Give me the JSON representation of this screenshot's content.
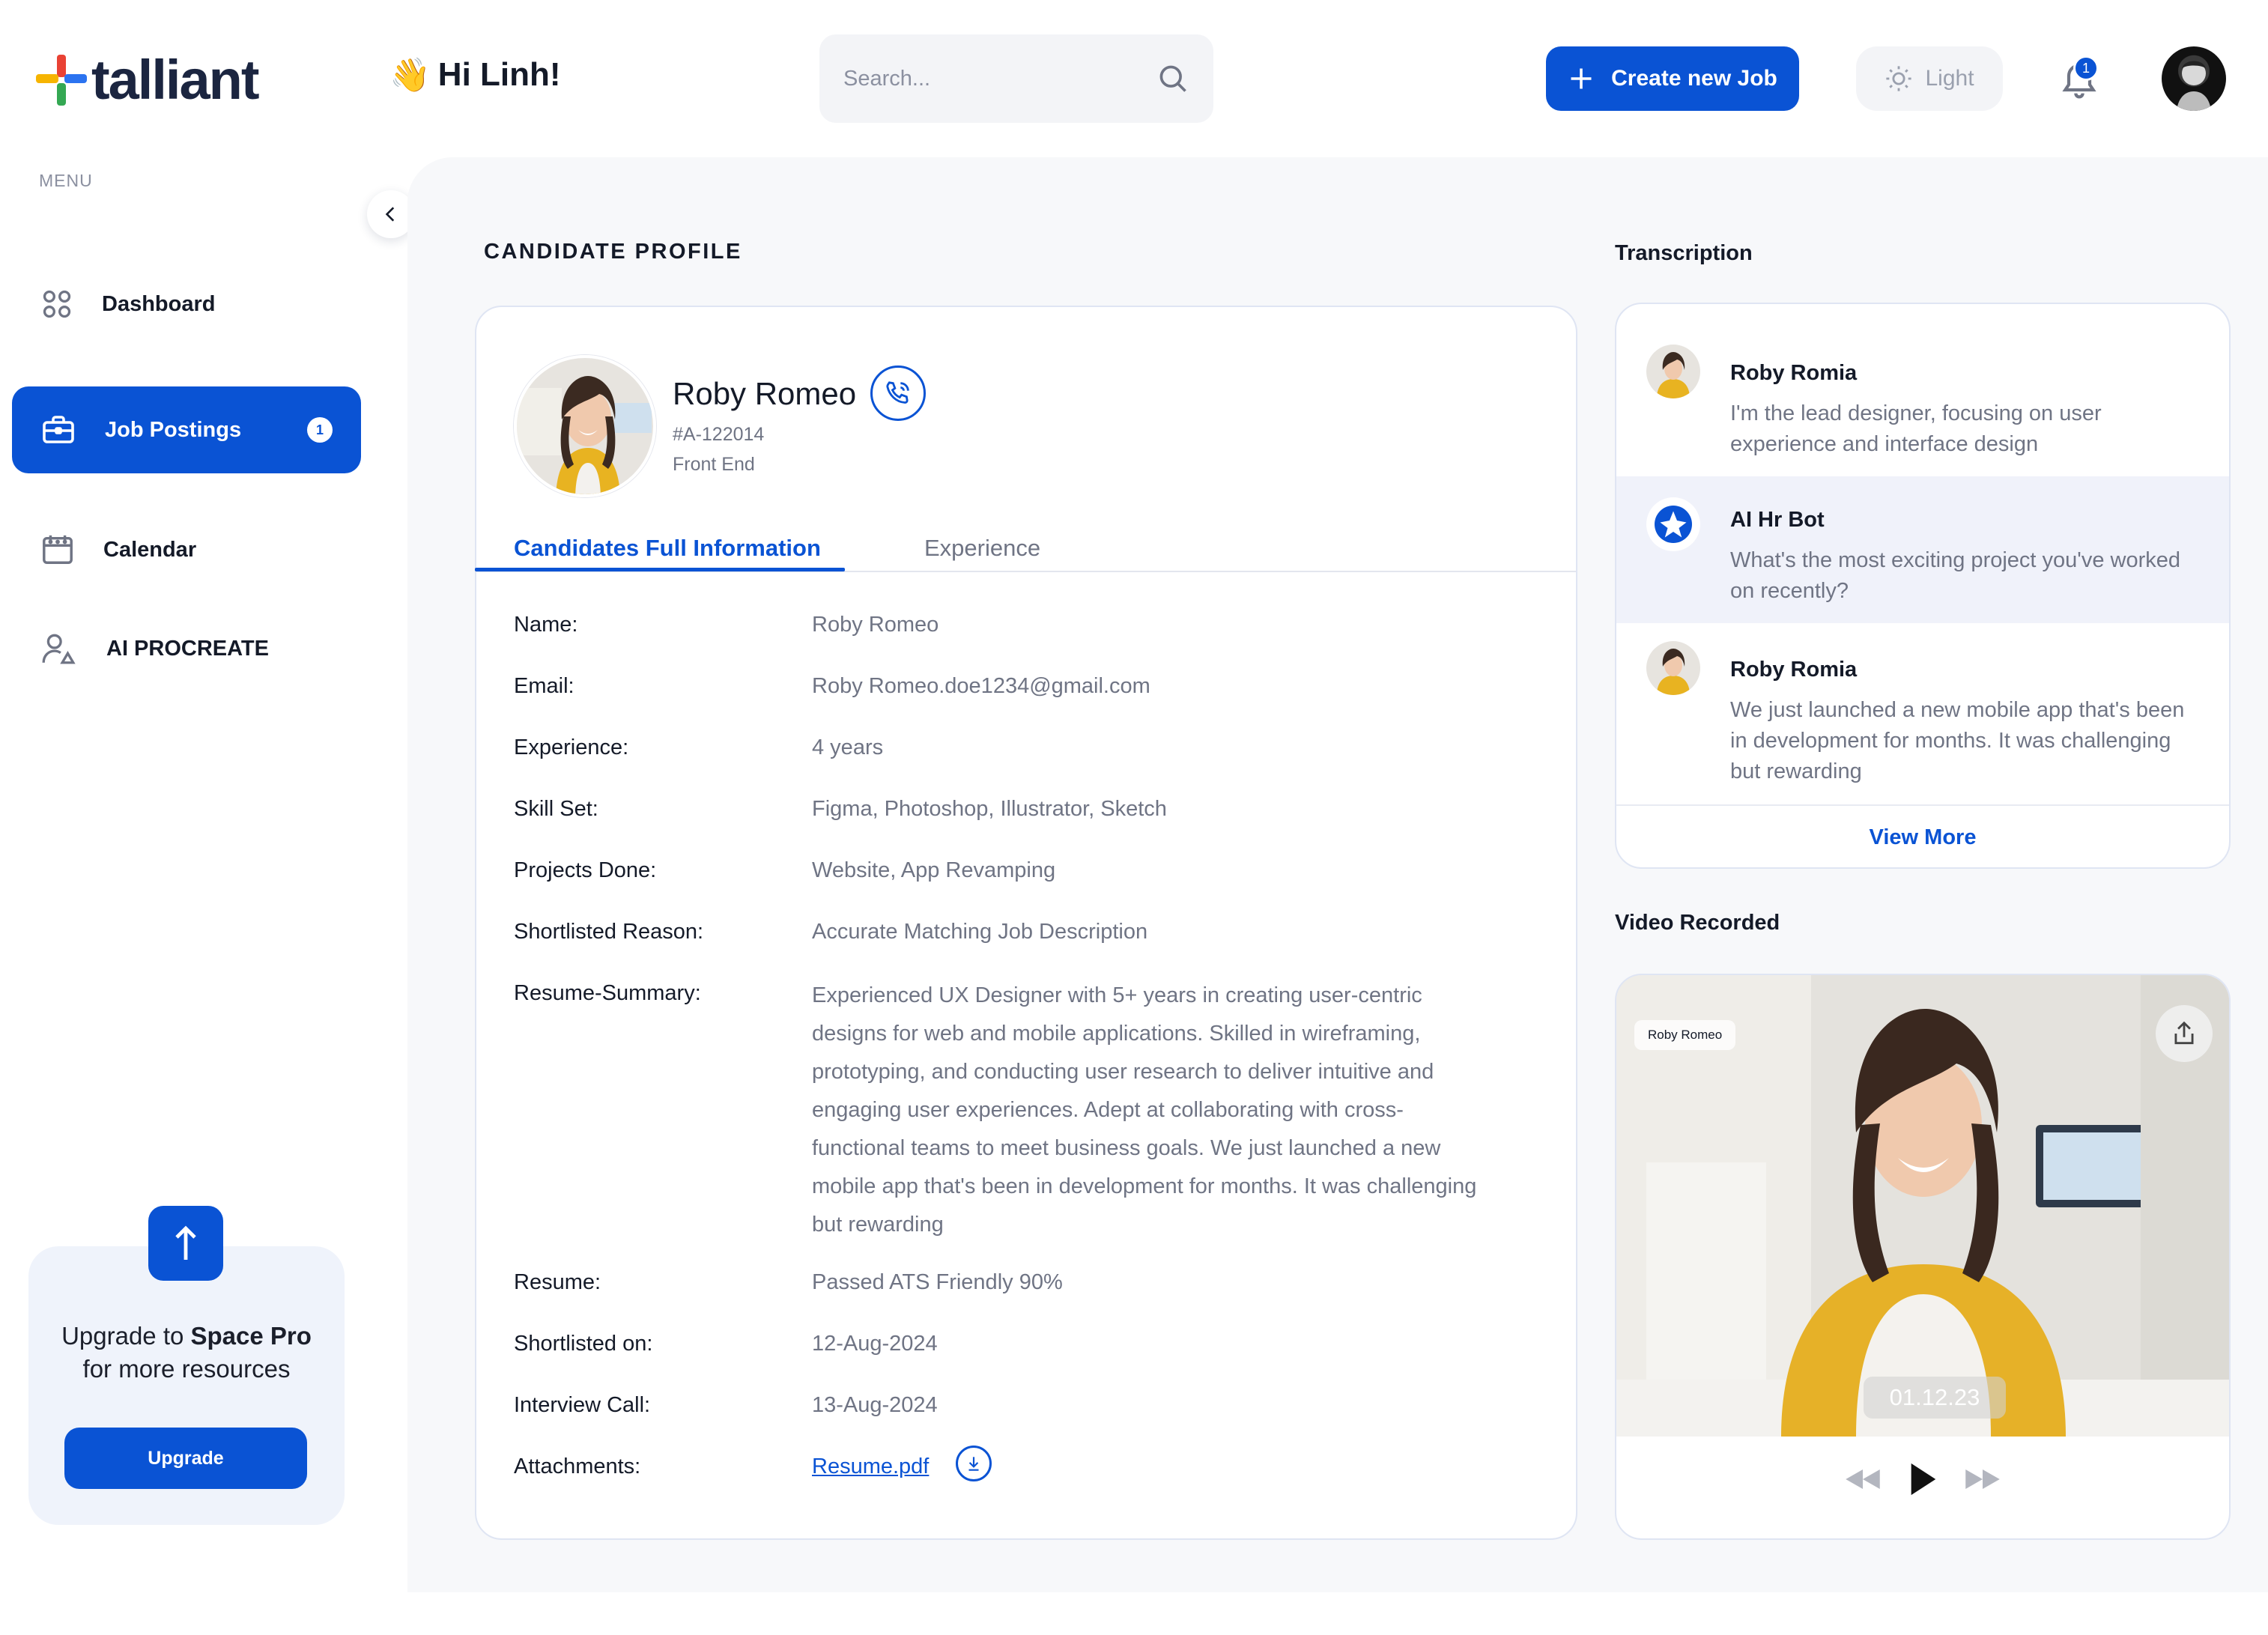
{
  "brand": {
    "name": "talliant",
    "colors": {
      "accent": "#0a53d4",
      "logo_red": "#e94234",
      "logo_yellow": "#f6b400",
      "logo_green": "#34a853",
      "logo_blue": "#2b73f0"
    }
  },
  "header": {
    "greeting_emoji": "👋",
    "greeting": "Hi Linh!",
    "search_placeholder": "Search...",
    "create_button": "Create new Job",
    "theme_label": "Light",
    "notification_count": "1"
  },
  "sidebar": {
    "menu_label": "MENU",
    "items": [
      {
        "label": "Dashboard",
        "icon": "grid-icon",
        "active": false
      },
      {
        "label": "Job Postings",
        "icon": "briefcase-icon",
        "active": true,
        "badge": "1"
      },
      {
        "label": "Calendar",
        "icon": "calendar-icon",
        "active": false
      },
      {
        "label": "AI PROCREATE",
        "icon": "user-ai-icon",
        "active": false
      }
    ],
    "upgrade": {
      "line1_prefix": "Upgrade to ",
      "line1_bold": "Space Pro",
      "line2": "for more resources",
      "button": "Upgrade"
    }
  },
  "profile": {
    "section_title": "CANDIDATE PROFILE",
    "name": "Roby Romeo",
    "id": "#A-122014",
    "role": "Front End",
    "tabs": [
      "Candidates Full Information",
      "Experience"
    ],
    "fields": [
      {
        "label": "Name:",
        "value": "Roby Romeo"
      },
      {
        "label": "Email:",
        "value": "Roby Romeo.doe1234@gmail.com"
      },
      {
        "label": "Experience:",
        "value": "4 years"
      },
      {
        "label": "Skill Set:",
        "value": "Figma, Photoshop, Illustrator, Sketch"
      },
      {
        "label": "Projects Done:",
        "value": "Website, App Revamping"
      },
      {
        "label": "Shortlisted Reason:",
        "value": "Accurate Matching Job Description"
      },
      {
        "label": "Resume-Summary:",
        "value": "Experienced UX Designer with 5+ years in creating user-centric designs for web and mobile applications. Skilled in wireframing, prototyping, and conducting user research to deliver intuitive and engaging user experiences. Adept at collaborating with cross-functional teams to meet business goals. We just launched a new mobile app that's been in development for months. It was challenging but rewarding"
      },
      {
        "label": "Resume:",
        "value": "Passed ATS Friendly 90%"
      },
      {
        "label": "Shortlisted on:",
        "value": "12-Aug-2024"
      },
      {
        "label": "Interview Call:",
        "value": "13-Aug-2024"
      },
      {
        "label": "Attachments:",
        "value": "Resume.pdf"
      }
    ]
  },
  "transcription": {
    "title": "Transcription",
    "messages": [
      {
        "speaker": "Roby Romia",
        "text": "I'm the lead designer, focusing on user experience and interface design"
      },
      {
        "speaker": "AI Hr Bot",
        "text": "What's the most exciting project you've worked on recently?"
      },
      {
        "speaker": "Roby Romia",
        "text": "We just launched a new mobile app that's been in development for months. It was challenging but rewarding"
      }
    ],
    "view_more": "View More"
  },
  "video": {
    "title": "Video Recorded",
    "tag": "Roby Romeo",
    "timestamp": "01.12.23"
  }
}
